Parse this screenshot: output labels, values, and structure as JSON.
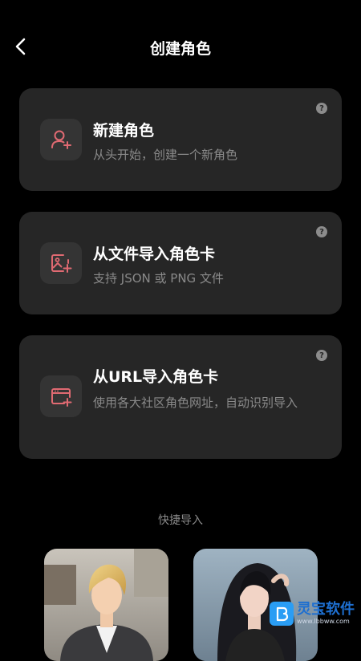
{
  "header": {
    "title": "创建角色"
  },
  "cards": [
    {
      "title": "新建角色",
      "desc": "从头开始，创建一个新角色",
      "help": "?"
    },
    {
      "title": "从文件导入角色卡",
      "desc": "支持 JSON 或 PNG 文件",
      "help": "?"
    },
    {
      "title": "从URL导入角色卡",
      "desc": "使用各大社区角色网址，自动识别导入",
      "help": "?"
    }
  ],
  "quick": {
    "label": "快捷导入"
  },
  "watermark": {
    "name": "灵宝软件",
    "url": "www.lbbww.com"
  },
  "colors": {
    "accent": "#e06a72",
    "card_bg": "#262626",
    "icon_bg": "#343434"
  }
}
